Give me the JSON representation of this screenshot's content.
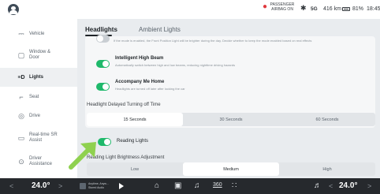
{
  "status_bar": {
    "airbag_text": "PASSENGER AIRBAG ON",
    "airbag_color": "#e0393e",
    "bluetooth": "✱",
    "signal": "5G",
    "range": "416 km",
    "battery_percent": "81%",
    "time": "18:45"
  },
  "sidebar": {
    "items": [
      {
        "icon": "⎓",
        "label": "Vehicle"
      },
      {
        "icon": "▢",
        "label": "Window & Door"
      },
      {
        "icon": "≡D",
        "label": "Lights"
      },
      {
        "icon": "⌐",
        "label": "Seat"
      },
      {
        "icon": "◎",
        "label": "Drive"
      },
      {
        "icon": "▭",
        "label": "Real-time SR Assist"
      },
      {
        "icon": "⊙",
        "label": "Driver Assistance"
      }
    ],
    "active_index": 2
  },
  "tabs": {
    "headlights": "Headlights",
    "ambient": "Ambient Lights"
  },
  "options": {
    "partial_desc": "If the mode is enabled, the Front Position Light will be brighter during the day. Decide whether to keep the mode enabled based on real effects",
    "high_beam_title": "Intelligent High Beam",
    "high_beam_desc": "Automatically switch between high and low beams, reducing nighttime driving hazards",
    "accompany_title": "Accompany Me Home",
    "accompany_desc": "Headlights are turned off later after locking the car",
    "delay_label": "Headlight Delayed Turning off Time",
    "delay_options": [
      "15 Seconds",
      "30 Seconds",
      "60 Seconds"
    ],
    "delay_selected": 0,
    "reading_title": "Reading Lights",
    "brightness_label": "Reading Light Brightness Adjustment",
    "brightness_options": [
      "Low",
      "Medium",
      "High"
    ],
    "brightness_selected": 1,
    "toggle_on_color": "#1fb96b"
  },
  "bottom_bar": {
    "left_temp": "24.0°",
    "right_temp": "24.0°",
    "left_chevron": "<",
    "left_chevron_r": ">",
    "right_chevron": "<",
    "right_chevron_r": ">",
    "media_text": "Anytime, Anyw... Stored Audio",
    "dock_icons": [
      "home-icon",
      "car-icon",
      "music-icon",
      "360-icon",
      "apps-icon",
      "volume-icon"
    ],
    "dock_360": "360"
  },
  "annotation_arrow_color": "#8fd14f"
}
